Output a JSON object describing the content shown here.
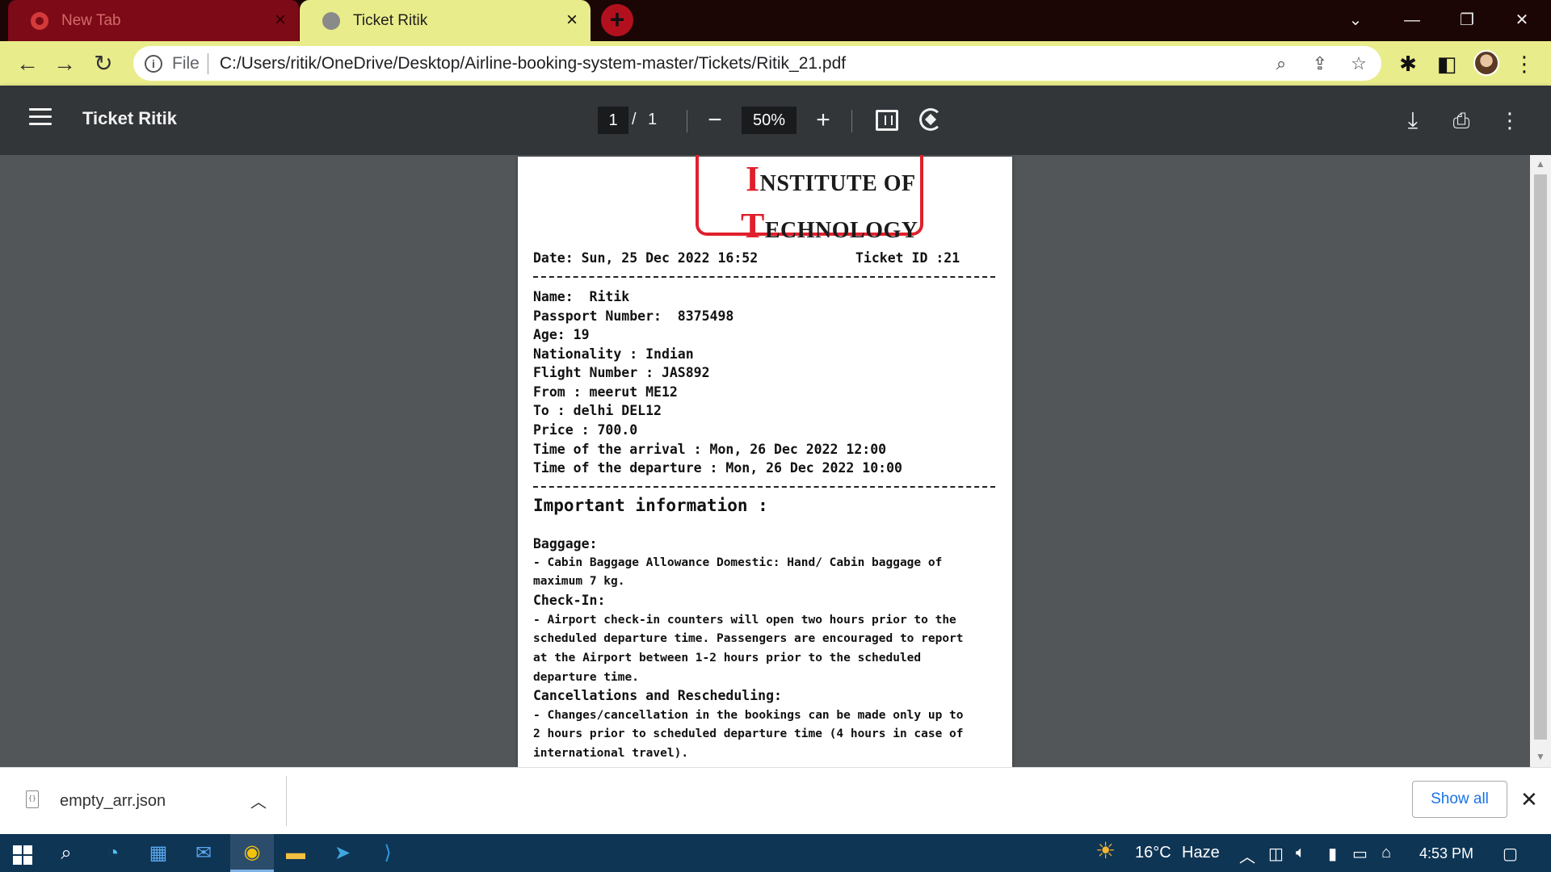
{
  "tabs": [
    {
      "label": "New Tab",
      "active": false
    },
    {
      "label": "Ticket Ritik",
      "active": true
    }
  ],
  "address_bar": {
    "scheme_label": "File",
    "url": "C:/Users/ritik/OneDrive/Desktop/Airline-booking-system-master/Tickets/Ritik_21.pdf"
  },
  "pdf_toolbar": {
    "title": "Ticket Ritik",
    "current_page": "1",
    "page_separator": "/",
    "total_pages": "1",
    "zoom": "50%"
  },
  "ticket": {
    "logo_line1_initial": "I",
    "logo_line1_rest": "NSTITUTE OF",
    "logo_line2_initial": "T",
    "logo_line2_rest": "ECHNOLOGY",
    "date_line": "Date: Sun, 25 Dec 2022 16:52",
    "ticket_id_line": "Ticket ID :21",
    "fields": [
      "Name:  Ritik",
      "Passport Number:  8375498",
      "Age: 19",
      "Nationality : Indian",
      "Flight Number : JAS892",
      "From : meerut ME12",
      "To : delhi DEL12",
      "Price : 700.0",
      "Time of the arrival : Mon, 26 Dec 2022 12:00",
      "Time of the departure : Mon, 26 Dec 2022 10:00"
    ],
    "important_title": "Important information :",
    "info_lines": [
      "Baggage:",
      "- Cabin Baggage Allowance Domestic: Hand/ Cabin baggage of",
      "maximum 7 kg.",
      "Check-In:",
      "- Airport check-in counters will open two hours prior to the",
      "scheduled departure time. Passengers are encouraged to report",
      "at the Airport between 1-2 hours prior to the scheduled",
      "departure time.",
      "Cancellations and Rescheduling:",
      "- Changes/cancellation in the bookings can be made only up to",
      "2 hours prior to scheduled departure time (4 hours in case of",
      "international travel)."
    ]
  },
  "download_bar": {
    "file_name": "empty_arr.json",
    "show_all_label": "Show all"
  },
  "taskbar": {
    "weather_temp": "16°C",
    "weather_desc": "Haze",
    "time": "4:53 PM"
  },
  "colors": {
    "tab_strip": "#1c0505",
    "toolbar_accent": "#e9ec8a",
    "pdf_toolbar": "#323639",
    "viewer_bg": "#525659",
    "logo_red": "#e0202c",
    "taskbar": "#0f3555",
    "link_blue": "#1a73e8"
  }
}
